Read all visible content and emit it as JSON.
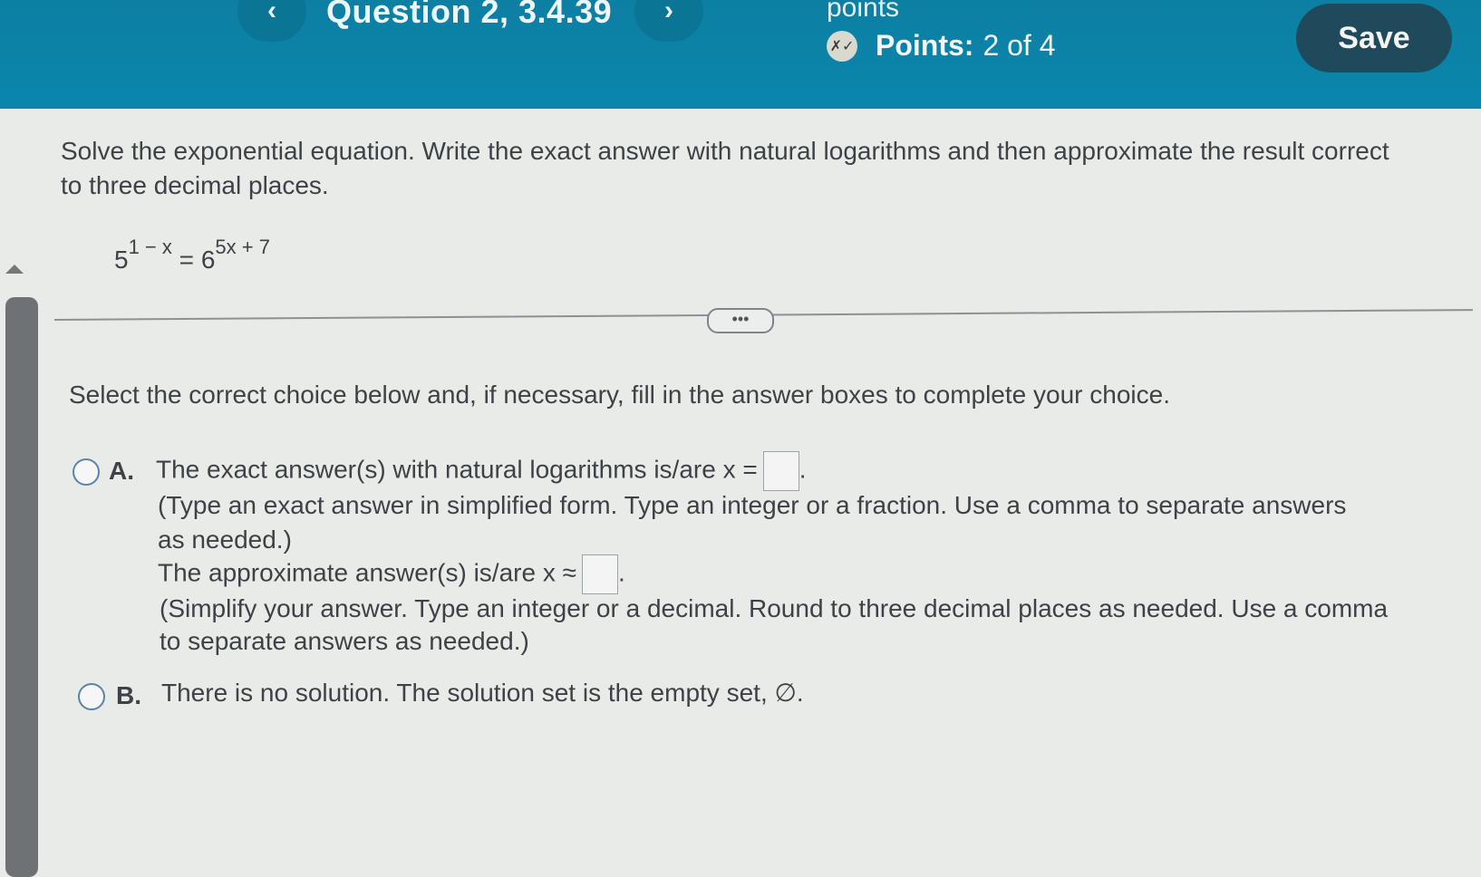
{
  "header": {
    "prev_icon": "‹",
    "question_title": "Question 2, 3.4.39",
    "next_icon": "›",
    "points_top": "points",
    "points_icon": "partial-credit-icon",
    "points_label": "Points:",
    "points_value": "2 of 4",
    "save_label": "Save"
  },
  "question": {
    "prompt": "Solve the exponential equation. Write the exact answer with natural logarithms and then approximate the result correct to three decimal places.",
    "equation": {
      "base_left": "5",
      "exp_left": "1 − x",
      "equals": "=",
      "base_right": "6",
      "exp_right": "5x + 7"
    }
  },
  "more_button": "•••",
  "instruction": "Select the correct choice below and, if necessary, fill in the answer boxes to complete your choice.",
  "choices": {
    "a": {
      "letter": "A.",
      "exact_label": "The exact answer(s) with natural logarithms is/are x =",
      "exact_value": "",
      "exact_hint_1": "(Type an exact answer in simplified form. Type an integer or a fraction. Use a comma to separate answers",
      "exact_hint_2": "as needed.)",
      "approx_label": "The approximate answer(s) is/are x ≈",
      "approx_value": "",
      "approx_hint_1": "(Simplify your answer. Type an integer or a decimal. Round to three decimal places as needed. Use a comma",
      "approx_hint_2": "to separate answers as needed.)"
    },
    "b": {
      "letter": "B.",
      "text": "There is no solution. The solution set is the empty set, ∅."
    }
  }
}
